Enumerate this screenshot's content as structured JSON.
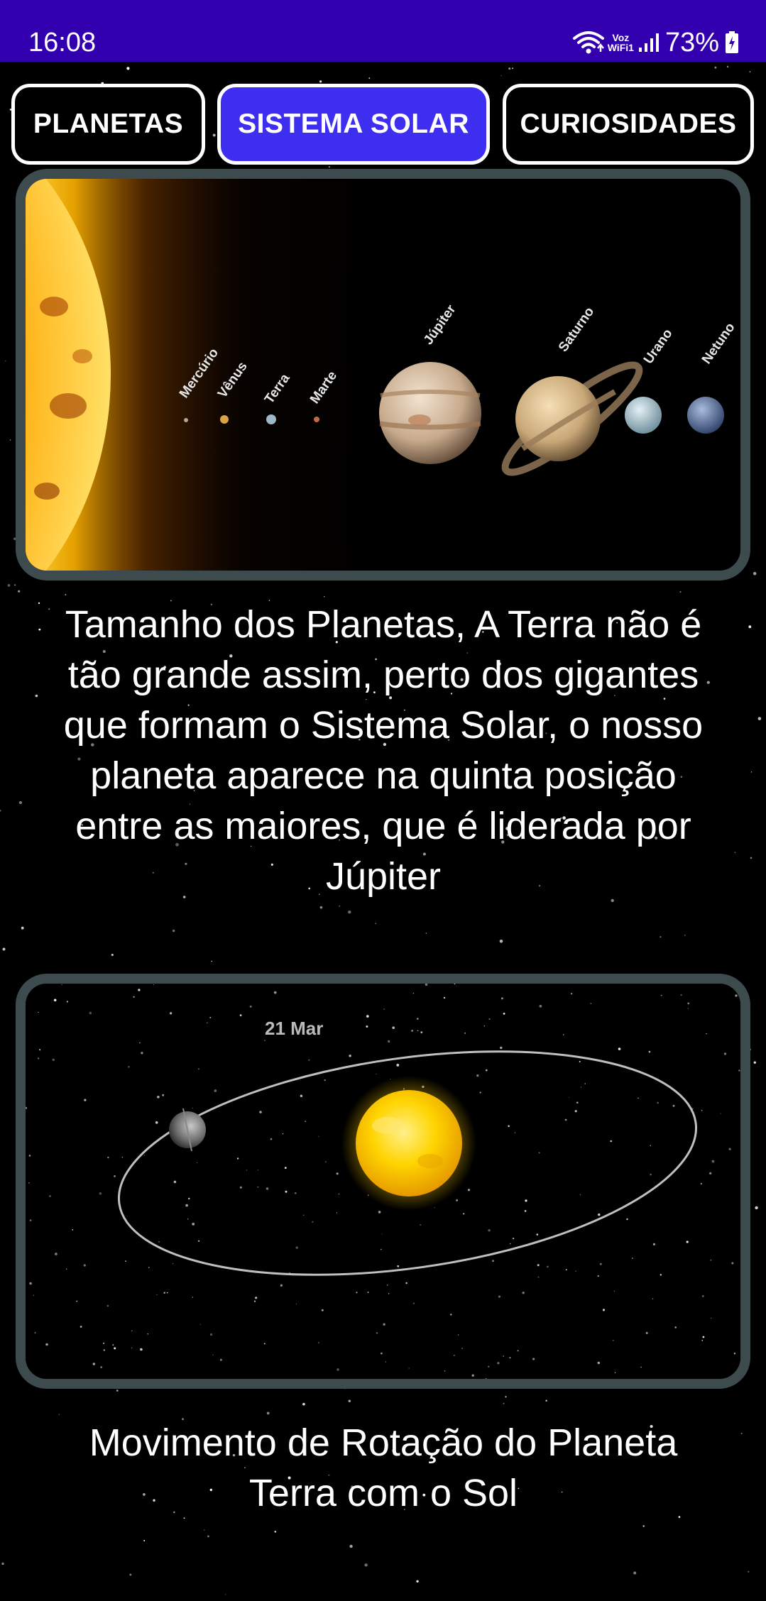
{
  "status_bar": {
    "time": "16:08",
    "wifi_label_line1": "Voz",
    "wifi_label_line2": "WiFi1",
    "battery": "73%",
    "icons": [
      "wifi-icon",
      "signal-icon",
      "battery-icon"
    ]
  },
  "tabs": [
    {
      "label": "PLANETAS",
      "active": false
    },
    {
      "label": "SISTEMA SOLAR",
      "active": true
    },
    {
      "label": "CURIOSIDADES",
      "active": false
    }
  ],
  "colors": {
    "status_bar": "#3300b0",
    "active_tab": "#3d2ef0",
    "frame_border": "#3d4a4e",
    "background": "#000000"
  },
  "content": [
    {
      "image": {
        "type": "planet-size-comparison",
        "labels": [
          "Mercúrio",
          "Vênus",
          "Terra",
          "Marte",
          "Júpiter",
          "Saturno",
          "Urano",
          "Netuno"
        ]
      },
      "caption": "Tamanho dos Planetas, A Terra não é tão grande assim, perto dos gigantes que formam o Sistema Solar, o nosso planeta aparece na quinta posição entre as maiores, que é liderada por Júpiter"
    },
    {
      "image": {
        "type": "earth-orbit-around-sun",
        "labels": [
          "21 Mar"
        ]
      },
      "caption": "Movimento de Rotação do Planeta Terra com o Sol"
    }
  ]
}
